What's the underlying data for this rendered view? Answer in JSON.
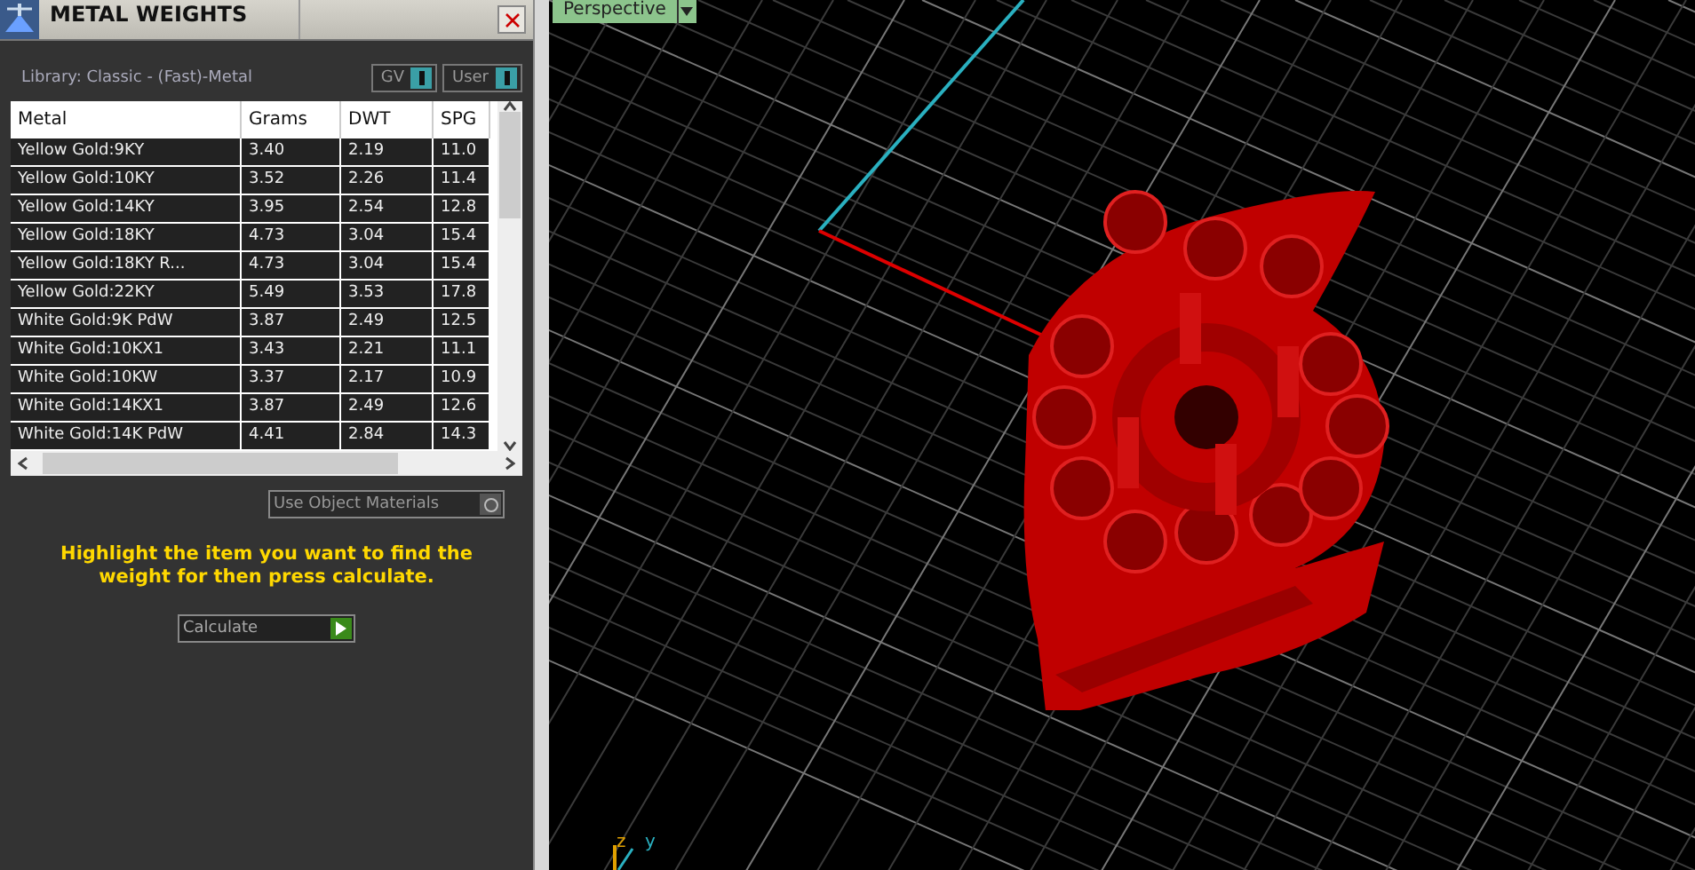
{
  "panel": {
    "title": "METAL WEIGHTS",
    "library": "Library: Classic - (Fast)-Metal",
    "toggles": [
      {
        "label": "GV",
        "on": true
      },
      {
        "label": "User",
        "on": true
      }
    ],
    "table": {
      "columns": [
        "Metal",
        "Grams",
        "DWT",
        "SPG"
      ],
      "rows": [
        [
          "Yellow Gold:9KY",
          "3.40",
          "2.19",
          "11.0"
        ],
        [
          "Yellow Gold:10KY",
          "3.52",
          "2.26",
          "11.4"
        ],
        [
          "Yellow Gold:14KY",
          "3.95",
          "2.54",
          "12.8"
        ],
        [
          "Yellow Gold:18KY",
          "4.73",
          "3.04",
          "15.4"
        ],
        [
          "Yellow Gold:18KY R...",
          "4.73",
          "3.04",
          "15.4"
        ],
        [
          "Yellow Gold:22KY",
          "5.49",
          "3.53",
          "17.8"
        ],
        [
          "White Gold:9K PdW",
          "3.87",
          "2.49",
          "12.5"
        ],
        [
          "White Gold:10KX1",
          "3.43",
          "2.21",
          "11.1"
        ],
        [
          "White Gold:10KW",
          "3.37",
          "2.17",
          "10.9"
        ],
        [
          "White Gold:14KX1",
          "3.87",
          "2.49",
          "12.6"
        ],
        [
          "White Gold:14K PdW",
          "4.41",
          "2.84",
          "14.3"
        ]
      ]
    },
    "object_materials": {
      "label": "Use Object Materials",
      "on": false
    },
    "hint": "Highlight the item you want to find the weight for then press calculate.",
    "calculate": "Calculate"
  },
  "viewport": {
    "view": "Perspective",
    "axes": [
      "z",
      "y"
    ]
  }
}
